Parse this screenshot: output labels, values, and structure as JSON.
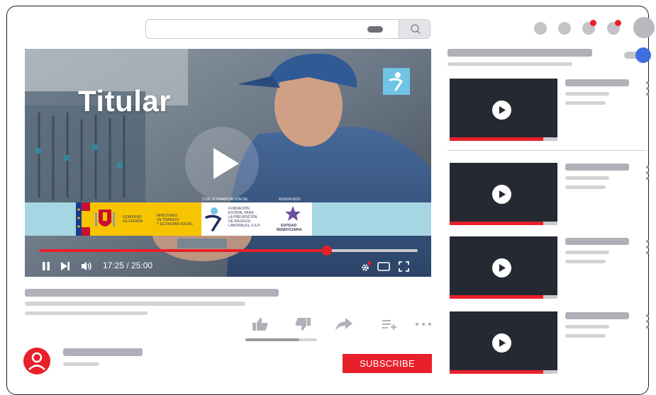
{
  "search": {
    "placeholder": ""
  },
  "player": {
    "title_overlay": "Titular",
    "time_display": "17:25 / 25:00",
    "progress": 0.76,
    "banner": {
      "funding_caption": "CON LA FINANCIACIÓN DE:",
      "code": "AS2024-0010",
      "gov_line1": "GOBIERNO",
      "gov_line2": "DE ESPAÑA",
      "ministry_line1": "MINISTERIO",
      "ministry_line2": "DE TRABAJO",
      "ministry_line3": "Y ECONOMÍA SOCIAL",
      "fund_line1": "FUNDACIÓN",
      "fund_line2": "ESTATAL PARA",
      "fund_line3": "LA PREVENCIÓN",
      "fund_line4": "DE RIESGOS",
      "fund_line5": "LABORALES, F.S.P.",
      "entity_line1": "ENTIDAD",
      "entity_line2": "BENEFICIARIA"
    }
  },
  "channel": {
    "subscribe_label": "SUBSCRIBE"
  },
  "sidebar": {
    "autoplay_on": true,
    "cards": [
      {
        "progress": 0.87
      },
      {
        "progress": 0.87
      },
      {
        "progress": 0.87
      },
      {
        "progress": 0.87
      }
    ]
  },
  "colors": {
    "accent_red": "#e8202a",
    "toggle_blue": "#3d6fe0",
    "banner_blue": "#a6d6e3",
    "gov_yellow": "#f7c500",
    "placeholder_gray": "#b0b0b8",
    "thumb_dark": "#252932"
  },
  "icons": {
    "search": "search-icon",
    "play": "play-icon",
    "pause": "pause-icon",
    "next": "skip-next-icon",
    "volume": "volume-icon",
    "settings": "gear-icon",
    "miniplayer": "miniplayer-icon",
    "fullscreen": "fullscreen-icon",
    "like": "thumbs-up-icon",
    "dislike": "thumbs-down-icon",
    "share": "share-icon",
    "save": "add-to-playlist-icon",
    "more": "more-horizontal-icon",
    "avatar": "user-avatar-icon",
    "kebab": "more-vertical-icon"
  }
}
